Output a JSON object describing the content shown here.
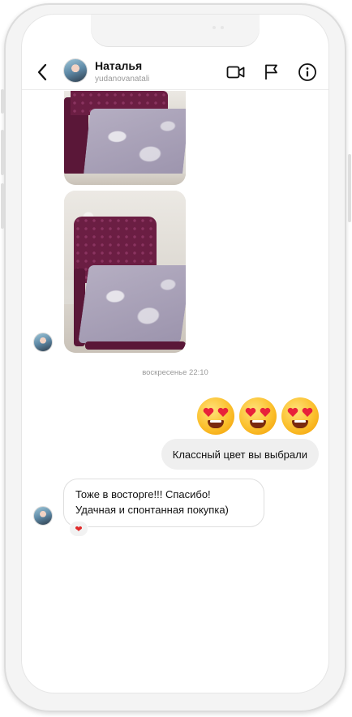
{
  "header": {
    "name": "Наталья",
    "username": "yudanovanatali",
    "icons": [
      "back-arrow-icon",
      "video-camera-icon",
      "flag-icon",
      "info-icon"
    ]
  },
  "messages": {
    "timestamp": "воскресенье 22:10",
    "emoji_count": 3,
    "emoji_name": "heart-eyes-emoji",
    "outgoing_text": "Классный цвет вы выбрали",
    "incoming_line1": "Тоже в восторге!!! Спасибо!",
    "incoming_line2": "Удачная и спонтанная покупка)",
    "reaction": "❤"
  },
  "colors": {
    "outgoing_bubble": "#efefef",
    "text": "#111111",
    "muted": "#9a9a9a",
    "bed_velvet": "#6b1e43"
  }
}
